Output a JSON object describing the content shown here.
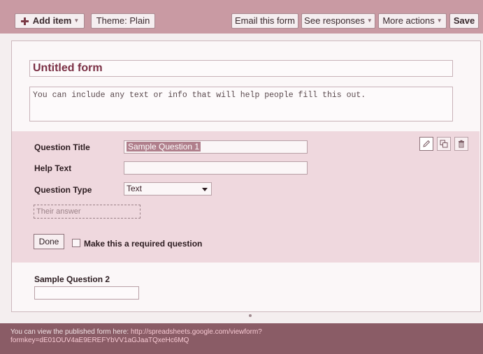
{
  "toolbar": {
    "add_item": "Add item",
    "theme": "Theme: Plain",
    "email_form": "Email this form",
    "see_responses": "See responses",
    "more_actions": "More actions",
    "save": "Save"
  },
  "form": {
    "title": "Untitled form",
    "description": "You can include any text or info that will help people fill this out."
  },
  "question_editor": {
    "title_label": "Question Title",
    "title_value": "Sample Question 1",
    "help_label": "Help Text",
    "help_value": "",
    "type_label": "Question Type",
    "type_value": "Text",
    "answer_placeholder": "Their answer",
    "done_label": "Done",
    "required_label": "Make this a required question",
    "required_checked": false
  },
  "question_2": {
    "title": "Sample Question 2"
  },
  "footer": {
    "text": "You can view the published form here: ",
    "url": "http://spreadsheets.google.com/viewform?formkey=dE01OUV4aE9EREFYbVV1aGJaaTQxeHc6MQ"
  },
  "icons": {
    "add": "plus-icon",
    "edit": "pencil-icon",
    "duplicate": "duplicate-icon",
    "delete": "trash-icon"
  },
  "colors": {
    "toolbar": "#c99aa3",
    "editor_bg": "#efd8de",
    "footer": "#8a5c66",
    "accent": "#7a2f44"
  }
}
